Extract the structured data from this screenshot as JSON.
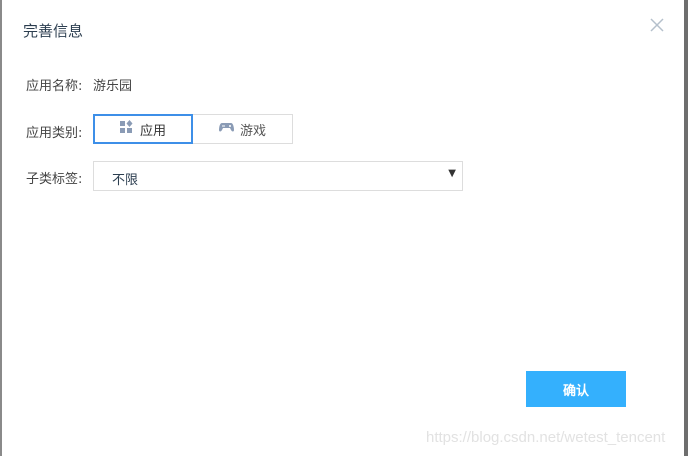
{
  "dialog": {
    "title": "完善信息",
    "close_icon": "close-icon",
    "fields": {
      "name_label": "应用名称:",
      "name_value": "游乐园",
      "category_label": "应用类别:",
      "category_options": [
        {
          "label": "应用",
          "icon": "apps-grid-icon",
          "selected": true
        },
        {
          "label": "游戏",
          "icon": "gamepad-icon",
          "selected": false
        }
      ],
      "subtag_label": "子类标签:",
      "subtag_value": "不限"
    },
    "confirm_label": "确认"
  },
  "watermark": "https://blog.csdn.net/wetest_tencent",
  "colors": {
    "accent": "#3d8fe8",
    "button": "#34b0fd"
  }
}
